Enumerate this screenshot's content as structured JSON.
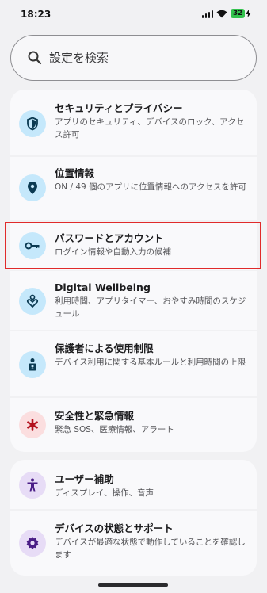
{
  "status_bar": {
    "time": "18:23",
    "battery": "32"
  },
  "search": {
    "placeholder": "設定を検索"
  },
  "items": [
    {
      "title": "セキュリティとプライバシー",
      "subtitle": "アプリのセキュリティ、デバイスのロック、アクセス許可",
      "icon": "shield-icon",
      "color": "#c5e8fb"
    },
    {
      "title": "位置情報",
      "subtitle": "ON / 49 個のアプリに位置情報へのアクセスを許可",
      "icon": "location-pin-icon",
      "color": "#c5e8fb"
    },
    {
      "title": "パスワードとアカウント",
      "subtitle": "ログイン情報や自動入力の候補",
      "icon": "key-icon",
      "color": "#c5e8fb"
    },
    {
      "title": "Digital Wellbeing",
      "subtitle": "利用時間、アプリタイマー、おやすみ時間のスケジュール",
      "icon": "wellbeing-icon",
      "color": "#c5e8fb"
    },
    {
      "title": "保護者による使用制限",
      "subtitle": "デバイス利用に関する基本ルールと利用時間の上限",
      "icon": "parental-controls-icon",
      "color": "#c5e8fb"
    },
    {
      "title": "安全性と緊急情報",
      "subtitle": "緊急 SOS、医療情報、アラート",
      "icon": "emergency-asterisk-icon",
      "color": "#fbdedf"
    },
    {
      "title": "ユーザー補助",
      "subtitle": "ディスプレイ、操作、音声",
      "icon": "accessibility-icon",
      "color": "#e7dcf6"
    },
    {
      "title": "デバイスの状態とサポート",
      "subtitle": "デバイスが最適な状態で動作していることを確認します",
      "icon": "device-health-icon",
      "color": "#e7dcf6"
    }
  ]
}
